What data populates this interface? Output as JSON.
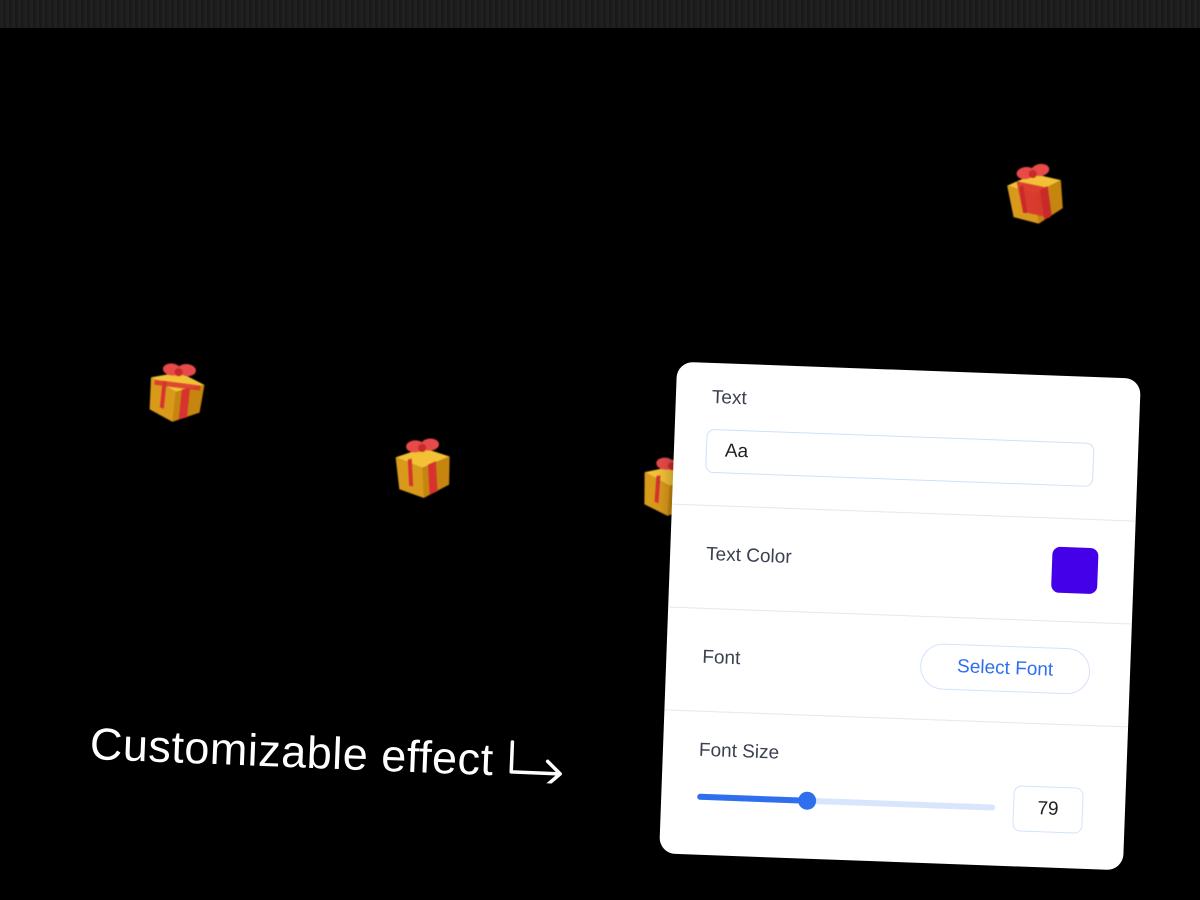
{
  "caption": {
    "text": "Customizable effect"
  },
  "icons": {
    "gift": "gift-icon",
    "arrow": "corner-arrow-right-icon"
  },
  "panel": {
    "text_section": {
      "label": "Text",
      "value": "Aa"
    },
    "color_section": {
      "label": "Text Color",
      "swatch_color": "#4400e8"
    },
    "font_section": {
      "label": "Font",
      "button_label": "Select Font"
    },
    "size_section": {
      "label": "Font Size",
      "value": "79",
      "slider_fraction": 0.37
    }
  },
  "colors": {
    "background": "#000000",
    "accent": "#2f6fee",
    "slider_track": "#d8e6fd"
  }
}
